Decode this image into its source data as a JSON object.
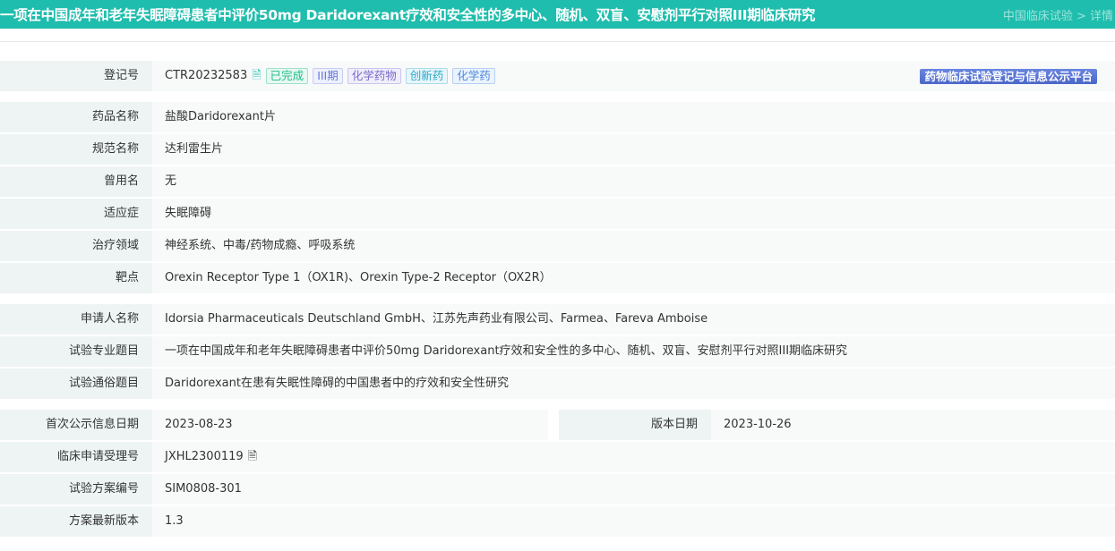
{
  "header": {
    "title": "一项在中国成年和老年失眠障碍患者中评价50mg Daridorexant疗效和安全性的多中心、随机、双盲、安慰剂平行对照III期临床研究",
    "breadcrumb": "中国临床试验 > 详情"
  },
  "registration": {
    "label": "登记号",
    "value": "CTR20232583",
    "tags": [
      "已完成",
      "III期",
      "化学药物",
      "创新药",
      "化学药"
    ],
    "platform": "药物临床试验登记与信息公示平台"
  },
  "drug": [
    {
      "label": "药品名称",
      "value": "盐酸Daridorexant片"
    },
    {
      "label": "规范名称",
      "value": "达利雷生片"
    },
    {
      "label": "曾用名",
      "value": "无"
    },
    {
      "label": "适应症",
      "value": "失眠障碍"
    },
    {
      "label": "治疗领域",
      "value": "神经系统、中毒/药物成瘾、呼吸系统"
    },
    {
      "label": "靶点",
      "value": "Orexin Receptor Type 1（OX1R)、Orexin Type-2 Receptor（OX2R）"
    }
  ],
  "applicant": [
    {
      "label": "申请人名称",
      "value": "Idorsia Pharmaceuticals Deutschland GmbH、江苏先声药业有限公司、Farmea、Fareva Amboise"
    },
    {
      "label": "试验专业题目",
      "value": "一项在中国成年和老年失眠障碍患者中评价50mg Daridorexant疗效和安全性的多中心、随机、双盲、安慰剂平行对照III期临床研究"
    },
    {
      "label": "试验通俗题目",
      "value": "Daridorexant在患有失眠性障碍的中国患者中的疗效和安全性研究"
    }
  ],
  "dates": {
    "first_label": "首次公示信息日期",
    "first_value": "2023-08-23",
    "version_label": "版本日期",
    "version_value": "2023-10-26"
  },
  "other": [
    {
      "label": "临床申请受理号",
      "value": "JXHL2300119"
    },
    {
      "label": "试验方案编号",
      "value": "SIM0808-301"
    },
    {
      "label": "方案最新版本",
      "value": "1.3"
    }
  ]
}
